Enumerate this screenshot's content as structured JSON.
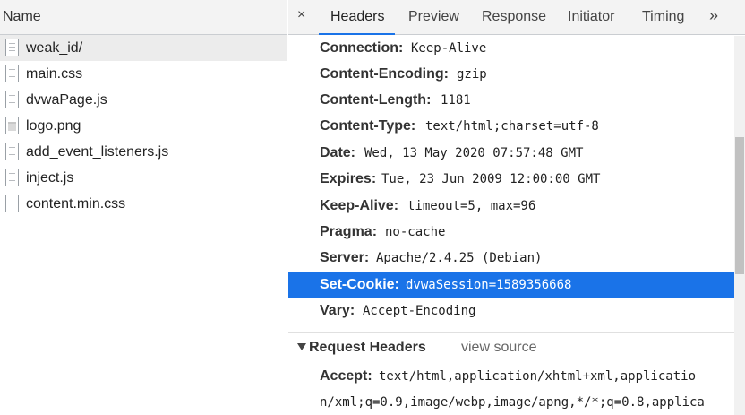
{
  "left_pane": {
    "header": "Name",
    "files": [
      {
        "name": "weak_id/",
        "icon": "document-icon",
        "selected": true
      },
      {
        "name": "main.css",
        "icon": "document-icon",
        "selected": false
      },
      {
        "name": "dvwaPage.js",
        "icon": "document-icon",
        "selected": false
      },
      {
        "name": "logo.png",
        "icon": "image-icon",
        "selected": false
      },
      {
        "name": "add_event_listeners.js",
        "icon": "document-icon",
        "selected": false
      },
      {
        "name": "inject.js",
        "icon": "document-icon",
        "selected": false
      },
      {
        "name": "content.min.css",
        "icon": "blank-file-icon",
        "selected": false
      }
    ]
  },
  "tabs": {
    "close": "×",
    "items": [
      "Headers",
      "Preview",
      "Response",
      "Initiator",
      "Timing"
    ],
    "active": "Headers",
    "more": "»"
  },
  "response_headers": [
    {
      "key": "Connection:",
      "value": "Keep-Alive"
    },
    {
      "key": "Content-Encoding:",
      "value": "gzip"
    },
    {
      "key": "Content-Length:",
      "value": "1181"
    },
    {
      "key": "Content-Type:",
      "value": "text/html;charset=utf-8"
    },
    {
      "key": "Date:",
      "value": "Wed, 13 May 2020 07:57:48 GMT"
    },
    {
      "key": "Expires:",
      "value": "Tue, 23 Jun 2009 12:00:00 GMT"
    },
    {
      "key": "Keep-Alive:",
      "value": "timeout=5, max=96"
    },
    {
      "key": "Pragma:",
      "value": "no-cache"
    },
    {
      "key": "Server:",
      "value": "Apache/2.4.25 (Debian)"
    },
    {
      "key": "Set-Cookie:",
      "value": "dvwaSession=1589356668",
      "selected": true
    },
    {
      "key": "Vary:",
      "value": "Accept-Encoding"
    }
  ],
  "request_headers": {
    "title": "Request Headers",
    "view_source": "view source",
    "accept_key": "Accept:",
    "accept_line1": "text/html,application/xhtml+xml,applicatio",
    "accept_line2": "n/xml;q=0.9,image/webp,image/apng,*/*;q=0.8,applica"
  },
  "colors": {
    "selection": "#1a73e8",
    "header_bg": "#f3f3f3",
    "selected_row": "#ececec"
  }
}
